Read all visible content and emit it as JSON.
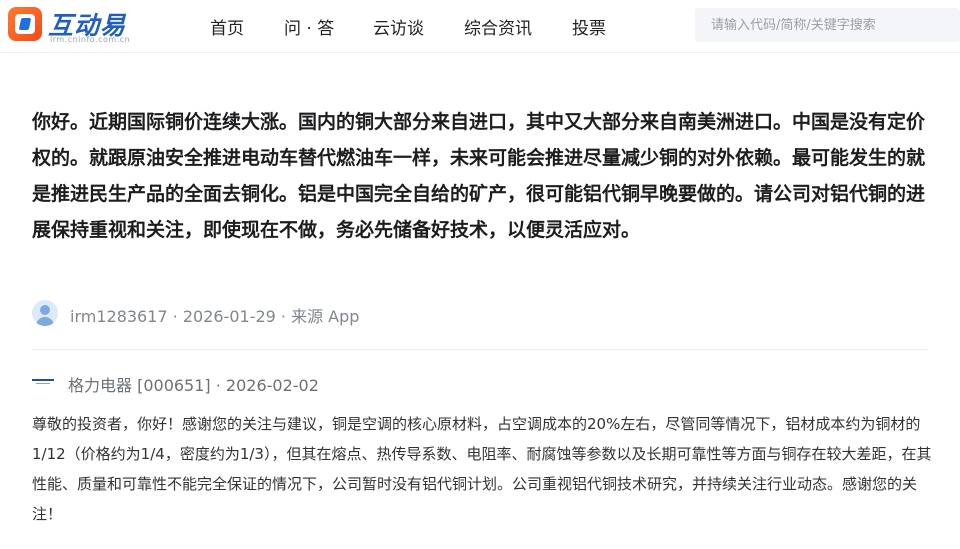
{
  "header": {
    "logo_name": "互动易",
    "logo_sub": "irm.cninfo.com.cn",
    "nav": [
      "首页",
      "问 · 答",
      "云访谈",
      "综合资讯",
      "投票"
    ],
    "search_placeholder": "请输入代码/简称/关键字搜索"
  },
  "question": {
    "text": "你好。近期国际铜价连续大涨。国内的铜大部分来自进口，其中又大部分来自南美洲进口。中国是没有定价权的。就跟原油安全推进电动车替代燃油车一样，未来可能会推进尽量减少铜的对外依赖。最可能发生的就是推进民生产品的全面去铜化。铝是中国完全自给的矿产，很可能铝代铜早晚要做的。请公司对铝代铜的进展保持重视和关注，即使现在不做，务必先储备好技术，以便灵活应对。",
    "meta": "irm1283617 · 2026-01-29 · 来源 App"
  },
  "answer": {
    "company_meta": "格力电器 [000651] · 2026-02-02",
    "text": "尊敬的投资者，你好！感谢您的关注与建议，铜是空调的核心原材料，占空调成本的20%左右，尽管同等情况下，铝材成本约为铜材的1/12（价格约为1/4，密度约为1/3），但其在熔点、热传导系数、电阻率、耐腐蚀等参数以及长期可靠性等方面与铜存在较大差距，在其性能、质量和可靠性不能完全保证的情况下，公司暂时没有铝代铜计划。公司重视铝代铜技术研究，并持续关注行业动态。感谢您的关注！"
  },
  "colors": {
    "brand_blue": "#1e5fbf",
    "brand_orange": "#f24a18"
  }
}
